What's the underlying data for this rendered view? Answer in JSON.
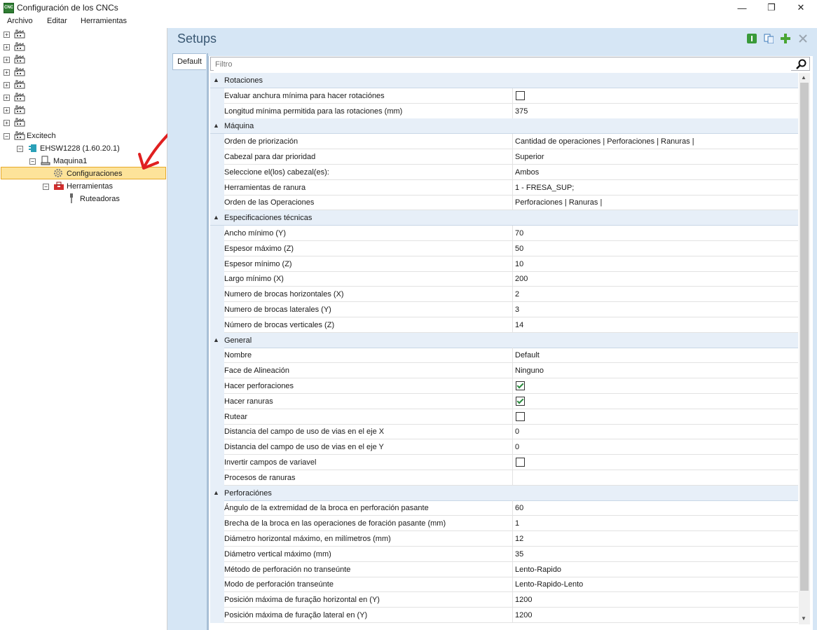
{
  "window": {
    "title": "Configuración de los CNCs",
    "icon_text": "CNC",
    "minimize": "—",
    "restore": "❐",
    "close": "✕"
  },
  "menu": [
    "Archivo",
    "Editar",
    "Herramientas"
  ],
  "tree": {
    "excitech": "Excitech",
    "machine": "EHSW1228 (1.60.20.1)",
    "maquina": "Maquina1",
    "config": "Configuraciones",
    "tools": "Herramientas",
    "router": "Ruteadoras"
  },
  "panel": {
    "title": "Setups",
    "tab": "Default",
    "filter_placeholder": "Filtro"
  },
  "grid": [
    {
      "cat": "Rotaciones"
    },
    {
      "name": "Evaluar anchura mínima para hacer rotaciónes",
      "check": false
    },
    {
      "name": "Longitud mínima permitida para las rotaciones (mm)",
      "value": "375"
    },
    {
      "cat": "Máquina"
    },
    {
      "name": "Orden de priorización",
      "value": "Cantidad de operaciones | Perforaciones | Ranuras |"
    },
    {
      "name": "Cabezal para dar prioridad",
      "value": "Superior"
    },
    {
      "name": "Seleccione el(los) cabezal(es):",
      "value": "Ambos"
    },
    {
      "name": "Herramientas de ranura",
      "value": "1 - FRESA_SUP;"
    },
    {
      "name": "Orden de las Operaciones",
      "value": "Perforaciones | Ranuras |"
    },
    {
      "cat": "Especificaciones técnicas"
    },
    {
      "name": "Ancho mínimo (Y)",
      "value": "70"
    },
    {
      "name": "Espesor máximo (Z)",
      "value": "50"
    },
    {
      "name": "Espesor mínimo (Z)",
      "value": "10"
    },
    {
      "name": "Largo mínimo (X)",
      "value": "200"
    },
    {
      "name": "Numero de brocas horizontales (X)",
      "value": "2"
    },
    {
      "name": "Numero de brocas laterales (Y)",
      "value": "3"
    },
    {
      "name": "Número de brocas verticales (Z)",
      "value": "14"
    },
    {
      "cat": "General"
    },
    {
      "name": "Nombre",
      "value": "Default"
    },
    {
      "name": "Face de Alineación",
      "value": "Ninguno"
    },
    {
      "name": "Hacer perforaciones",
      "check": true
    },
    {
      "name": "Hacer ranuras",
      "check": true
    },
    {
      "name": "Rutear",
      "check": false
    },
    {
      "name": "Distancia del campo de uso de vias en el eje X",
      "value": "0"
    },
    {
      "name": "Distancia del campo de uso de vias en el eje Y",
      "value": "0"
    },
    {
      "name": "Invertir campos de variavel",
      "check": false
    },
    {
      "name": "Procesos de ranuras",
      "value": ""
    },
    {
      "cat": "Perforaciónes"
    },
    {
      "name": "Ángulo de la extremidad de la broca en perforación pasante",
      "value": "60"
    },
    {
      "name": "Brecha de la broca en las operaciones de foración pasante (mm)",
      "value": "1"
    },
    {
      "name": "Diámetro horizontal máximo, en milímetros (mm)",
      "value": "12"
    },
    {
      "name": "Diámetro vertical máximo (mm)",
      "value": "35"
    },
    {
      "name": "Método de perforación no transeúnte",
      "value": "Lento-Rapido"
    },
    {
      "name": "Modo de perforación transeúnte",
      "value": "Lento-Rapido-Lento"
    },
    {
      "name": "Posición máxima de furação horizontal en (Y)",
      "value": "1200"
    },
    {
      "name": "Posición máxima de furação lateral en (Y)",
      "value": "1200"
    }
  ],
  "colors": {
    "selection": "#fde39a",
    "panel_bg": "#d6e6f5",
    "arrow": "#e02020"
  }
}
